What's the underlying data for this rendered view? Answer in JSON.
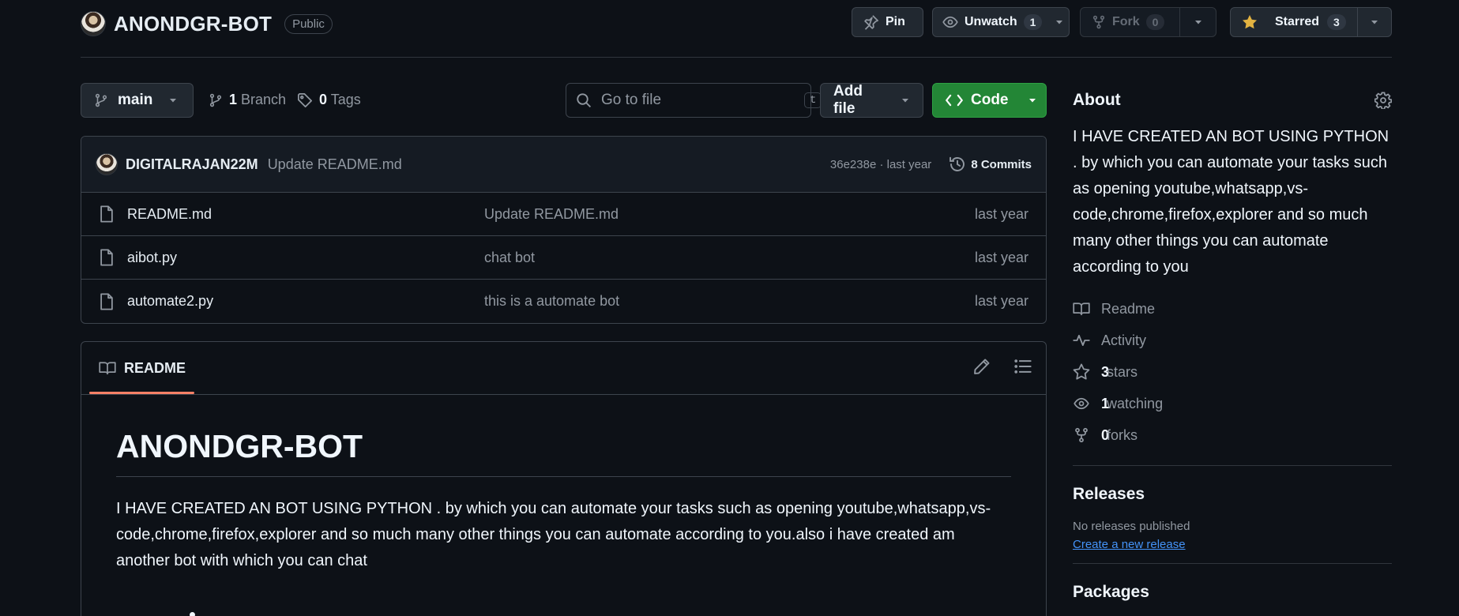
{
  "repo": {
    "name": "ANONDGR-BOT",
    "visibility": "Public"
  },
  "header_actions": {
    "pin_label": "Pin",
    "unwatch_label": "Unwatch",
    "watch_count": "1",
    "fork_label": "Fork",
    "fork_count": "0",
    "starred_label": "Starred",
    "star_count": "3"
  },
  "toolbar": {
    "branch": "main",
    "branch_count": "1",
    "branch_label": "Branch",
    "tag_count": "0",
    "tag_label": "Tags",
    "search_placeholder": "Go to file",
    "search_shortcut": "t",
    "add_file_label": "Add file",
    "code_label": "Code"
  },
  "latest_commit": {
    "author": "DIGITALRAJAN22M",
    "message": "Update README.md",
    "sha_time": "36e238e · last year",
    "commits_label": "8 Commits"
  },
  "files": [
    {
      "name": "README.md",
      "message": "Update README.md",
      "date": "last year"
    },
    {
      "name": "aibot.py",
      "message": "chat bot",
      "date": "last year"
    },
    {
      "name": "automate2.py",
      "message": "this is a automate bot",
      "date": "last year"
    }
  ],
  "readme": {
    "tab_label": "README",
    "heading": "ANONDGR-BOT",
    "paragraph": "I HAVE CREATED AN BOT USING PYTHON . by which you can automate your tasks such as opening youtube,whatsapp,vs-code,chrome,firefox,explorer and so much many other things you can automate according to you.also i have created am another bot with which you can chat"
  },
  "about": {
    "title": "About",
    "description": "I HAVE CREATED AN BOT USING PYTHON . by which you can automate your tasks such as opening youtube,whatsapp,vs-code,chrome,firefox,explorer and so much many other things you can automate according to you",
    "readme_label": "Readme",
    "activity_label": "Activity",
    "stars_count": "3",
    "stars_label": "stars",
    "watching_count": "1",
    "watching_label": "watching",
    "forks_count": "0",
    "forks_label": "forks"
  },
  "releases": {
    "title": "Releases",
    "none_text": "No releases published",
    "create_link": "Create a new release"
  },
  "packages": {
    "title": "Packages"
  },
  "colors": {
    "background": "#0d1117",
    "border": "#3d444d",
    "code_button": "#238636",
    "star_icon": "#e3b341",
    "link": "#4493f8",
    "tab_underline": "#f78166"
  }
}
